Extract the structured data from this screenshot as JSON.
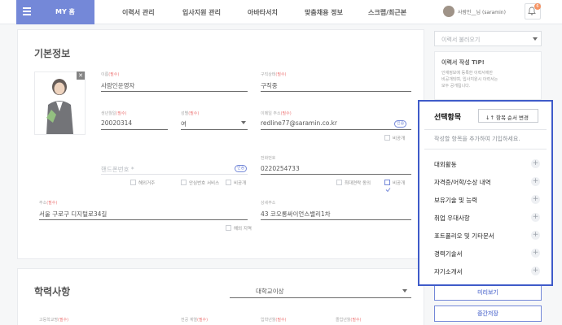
{
  "nav": {
    "home_label": "MY 홈",
    "items": [
      "이력서 관리",
      "입사지원 관리",
      "아바타서치",
      "맞춤채용 정보",
      "스크랩/최근본"
    ],
    "user_label": "사람인__님 (saramin)",
    "notif_count": "6"
  },
  "basic": {
    "title": "기본정보",
    "name_label": "이름",
    "name_value": "사람인운영자",
    "status_label": "구직상태",
    "status_value": "구직중",
    "birth_label": "생년월일",
    "birth_value": "20020314",
    "gender_label": "성별",
    "gender_value": "여",
    "email_label": "이메일 주소",
    "email_value": "redline77@saramin.co.kr",
    "mobile_placeholder": "핸드폰번호 *",
    "phone_label": "전화번호",
    "phone_value": "0220254733",
    "address_label": "주소",
    "address_value": "서울 구로구 디지털로34길",
    "detail_label": "상세주소",
    "detail_value": "43 코오롱싸이언스밸리1차",
    "required_mark": "(필수)",
    "auth_tag": "인증",
    "private_label": "비공개",
    "overseas_label": "해외거주",
    "safe_number_label": "안심번호 서비스",
    "top_contact_label": "최대연락 동의",
    "overseas_addr_label": "해외 지역"
  },
  "education": {
    "title": "학력사항",
    "level_value": "대학교이상",
    "col_labels": [
      "고등학교명",
      "전공 계열",
      "입학년월",
      "졸업년월"
    ]
  },
  "side": {
    "load_resume": "이력서 불러오기",
    "tips_title": "이력서 작성 TIP!",
    "tips_text": [
      "인재정보에 등록한 이력서에만",
      "비공개되며, 입사지원시 이력서는",
      "모두 공개됩니다."
    ],
    "preview": "미리보기",
    "save": "중간저장"
  },
  "popover": {
    "title": "선택항목",
    "order_btn": "↓↑ 항목 순서 변경",
    "hint": "작성할 항목을 추가하여 기입하세요.",
    "items": [
      "대외활동",
      "자격증/어학/수상 내역",
      "보유기술 및 능력",
      "취업 우대사항",
      "포트폴리오 및 기타문서",
      "경력기술서",
      "자기소개서"
    ]
  }
}
